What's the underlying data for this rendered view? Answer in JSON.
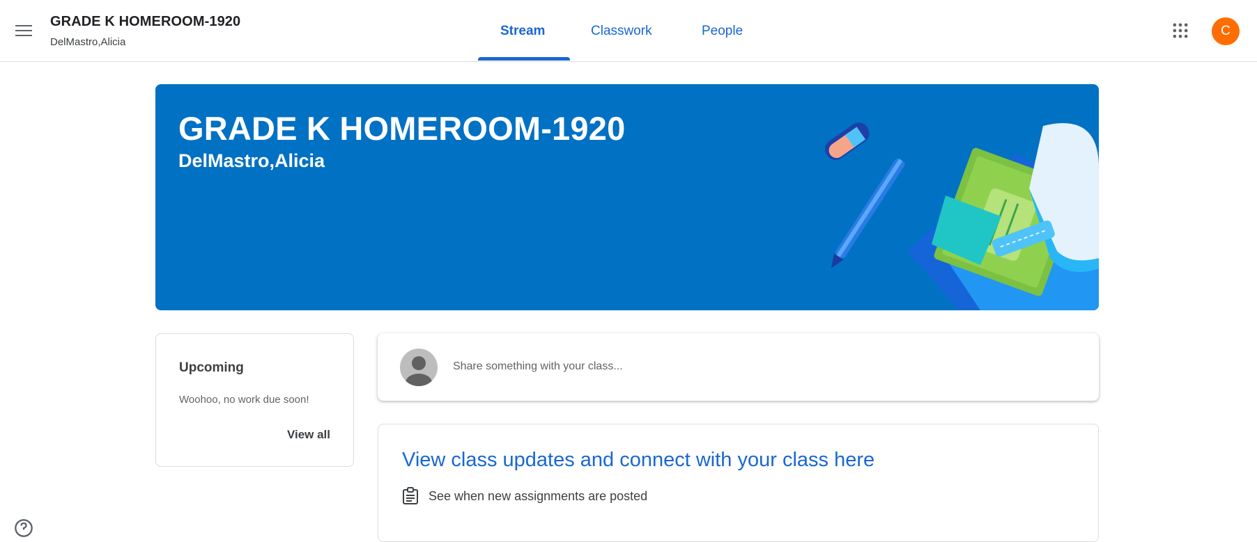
{
  "header": {
    "class_title": "GRADE K HOMEROOM-1920",
    "class_teacher": "DelMastro,Alicia",
    "tabs": [
      {
        "label": "Stream",
        "active": true
      },
      {
        "label": "Classwork",
        "active": false
      },
      {
        "label": "People",
        "active": false
      }
    ],
    "account_initial": "C",
    "icons": [
      "menu-icon",
      "apps-grid-icon"
    ],
    "accent_color": "#1967d2",
    "avatar_color": "#ff6d00"
  },
  "banner": {
    "title": "GRADE K HOMEROOM-1920",
    "subtitle": "DelMastro,Alicia",
    "background_color": "#0171c4"
  },
  "upcoming": {
    "title": "Upcoming",
    "message": "Woohoo, no work due soon!",
    "link": "View all"
  },
  "share": {
    "placeholder": "Share something with your class..."
  },
  "updates": {
    "title": "View class updates and connect with your class here",
    "items": [
      {
        "icon": "assignment-icon",
        "text": "See when new assignments are posted"
      }
    ]
  }
}
